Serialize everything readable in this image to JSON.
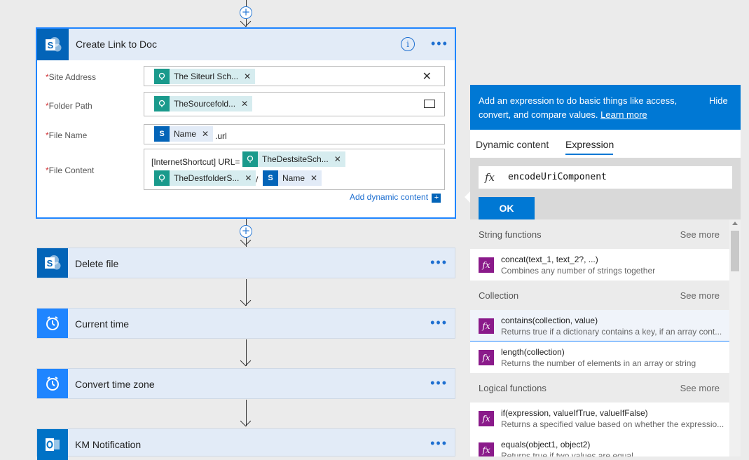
{
  "flow": {
    "main_card": {
      "title": "Create Link to Doc",
      "fields": {
        "site_address": {
          "label": "Site Address",
          "token": "The Siteurl Sch..."
        },
        "folder_path": {
          "label": "Folder Path",
          "token": "TheSourcefold..."
        },
        "file_name": {
          "label": "File Name",
          "token": "Name",
          "suffix": ".url"
        },
        "file_content": {
          "label": "File Content",
          "prefix": "[InternetShortcut] URL=",
          "token1": "TheDestsiteSch...",
          "token2": "TheDestfolderS...",
          "separator": "/",
          "token3": "Name"
        }
      },
      "add_dynamic": "Add dynamic content"
    },
    "cards": [
      {
        "title": "Delete file"
      },
      {
        "title": "Current time"
      },
      {
        "title": "Convert time zone"
      },
      {
        "title": "KM Notification"
      }
    ]
  },
  "panel": {
    "header_text": "Add an expression to do basic things like access, convert, and compare values.",
    "learn_more": "Learn more",
    "hide": "Hide",
    "tabs": {
      "dynamic": "Dynamic content",
      "expression": "Expression"
    },
    "expression_value": "encodeUriComponent",
    "fx": "fx",
    "ok": "OK",
    "sections": [
      {
        "title": "String functions",
        "see_more": "See more"
      },
      {
        "title": "Collection",
        "see_more": "See more"
      },
      {
        "title": "Logical functions",
        "see_more": "See more"
      }
    ],
    "functions": {
      "concat": {
        "name": "concat(text_1, text_2?, ...)",
        "desc": "Combines any number of strings together"
      },
      "contains": {
        "name": "contains(collection, value)",
        "desc": "Returns true if a dictionary contains a key, if an array cont..."
      },
      "length": {
        "name": "length(collection)",
        "desc": "Returns the number of elements in an array or string"
      },
      "if": {
        "name": "if(expression, valueIfTrue, valueIfFalse)",
        "desc": "Returns a specified value based on whether the expressio..."
      },
      "equals": {
        "name": "equals(object1, object2)",
        "desc": "Returns true if two values are equal"
      }
    }
  },
  "colors": {
    "accent": "#0078d4",
    "sharepoint": "#0364b8",
    "teal": "#1a9a8c",
    "function_icon": "#8a1a8a"
  }
}
